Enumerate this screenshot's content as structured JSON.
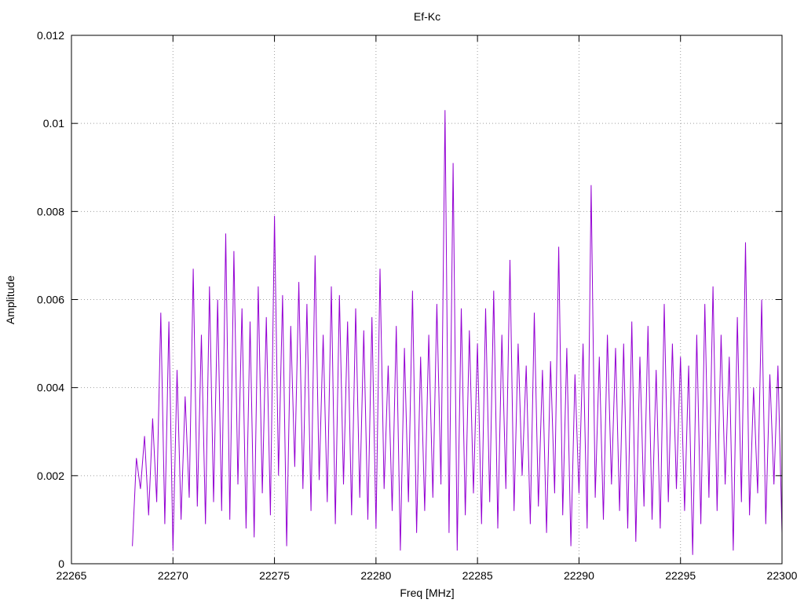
{
  "chart_data": {
    "type": "line",
    "title": "Ef-Kc",
    "xlabel": "Freq [MHz]",
    "ylabel": "Amplitude",
    "xlim": [
      22265,
      22300
    ],
    "ylim": [
      0,
      0.012
    ],
    "grid": true,
    "x_ticks": [
      "22265",
      "22270",
      "22275",
      "22280",
      "22285",
      "22290",
      "22295",
      "22300"
    ],
    "y_ticks": [
      "0",
      "0.002",
      "0.004",
      "0.006",
      "0.008",
      "0.01",
      "0.012"
    ],
    "series": [
      {
        "color": "#9400d3",
        "x": [
          22268.0,
          22268.2,
          22268.4,
          22268.6,
          22268.8,
          22269.0,
          22269.2,
          22269.4,
          22269.6,
          22269.8,
          22270.0,
          22270.2,
          22270.4,
          22270.6,
          22270.8,
          22271.0,
          22271.2,
          22271.4,
          22271.6,
          22271.8,
          22272.0,
          22272.2,
          22272.4,
          22272.6,
          22272.8,
          22273.0,
          22273.2,
          22273.4,
          22273.6,
          22273.8,
          22274.0,
          22274.2,
          22274.4,
          22274.6,
          22274.8,
          22275.0,
          22275.2,
          22275.4,
          22275.6,
          22275.8,
          22276.0,
          22276.2,
          22276.4,
          22276.6,
          22276.8,
          22277.0,
          22277.2,
          22277.4,
          22277.6,
          22277.8,
          22278.0,
          22278.2,
          22278.4,
          22278.6,
          22278.8,
          22279.0,
          22279.2,
          22279.4,
          22279.6,
          22279.8,
          22280.0,
          22280.2,
          22280.4,
          22280.6,
          22280.8,
          22281.0,
          22281.2,
          22281.4,
          22281.6,
          22281.8,
          22282.0,
          22282.2,
          22282.4,
          22282.6,
          22282.8,
          22283.0,
          22283.2,
          22283.4,
          22283.6,
          22283.8,
          22284.0,
          22284.2,
          22284.4,
          22284.6,
          22284.8,
          22285.0,
          22285.2,
          22285.4,
          22285.6,
          22285.8,
          22286.0,
          22286.2,
          22286.4,
          22286.6,
          22286.8,
          22287.0,
          22287.2,
          22287.4,
          22287.6,
          22287.8,
          22288.0,
          22288.2,
          22288.4,
          22288.6,
          22288.8,
          22289.0,
          22289.2,
          22289.4,
          22289.6,
          22289.8,
          22290.0,
          22290.2,
          22290.4,
          22290.6,
          22290.8,
          22291.0,
          22291.2,
          22291.4,
          22291.6,
          22291.8,
          22292.0,
          22292.2,
          22292.4,
          22292.6,
          22292.8,
          22293.0,
          22293.2,
          22293.4,
          22293.6,
          22293.8,
          22294.0,
          22294.2,
          22294.4,
          22294.6,
          22294.8,
          22295.0,
          22295.2,
          22295.4,
          22295.6,
          22295.8,
          22296.0,
          22296.2,
          22296.4,
          22296.6,
          22296.8,
          22297.0,
          22297.2,
          22297.4,
          22297.6,
          22297.8,
          22298.0,
          22298.2,
          22298.4,
          22298.6,
          22298.8,
          22299.0,
          22299.2,
          22299.4,
          22299.6,
          22299.8,
          22300.0
        ],
        "y": [
          0.0004,
          0.0024,
          0.0017,
          0.0029,
          0.0011,
          0.0033,
          0.0014,
          0.0057,
          0.0009,
          0.0055,
          0.0003,
          0.0044,
          0.001,
          0.0038,
          0.0015,
          0.0067,
          0.0013,
          0.0052,
          0.0009,
          0.0063,
          0.0014,
          0.006,
          0.0012,
          0.0075,
          0.001,
          0.0071,
          0.0018,
          0.0058,
          0.0008,
          0.0055,
          0.0006,
          0.0063,
          0.0016,
          0.0056,
          0.0011,
          0.0079,
          0.002,
          0.0061,
          0.0004,
          0.0054,
          0.0022,
          0.0064,
          0.0017,
          0.0059,
          0.0012,
          0.007,
          0.0019,
          0.0052,
          0.0014,
          0.0063,
          0.0009,
          0.0061,
          0.0018,
          0.0055,
          0.0011,
          0.0058,
          0.0015,
          0.0053,
          0.001,
          0.0056,
          0.0008,
          0.0067,
          0.0017,
          0.0045,
          0.0012,
          0.0054,
          0.0003,
          0.0049,
          0.0014,
          0.0062,
          0.0007,
          0.0047,
          0.0012,
          0.0052,
          0.0015,
          0.0059,
          0.0018,
          0.0103,
          0.0007,
          0.0091,
          0.0003,
          0.0058,
          0.0011,
          0.0053,
          0.0016,
          0.005,
          0.0009,
          0.0058,
          0.0014,
          0.0062,
          0.0008,
          0.0052,
          0.0017,
          0.0069,
          0.0012,
          0.005,
          0.002,
          0.0045,
          0.0009,
          0.0057,
          0.0013,
          0.0044,
          0.0007,
          0.0046,
          0.0016,
          0.0072,
          0.0011,
          0.0049,
          0.0004,
          0.0043,
          0.0016,
          0.005,
          0.0008,
          0.0086,
          0.0015,
          0.0047,
          0.001,
          0.0052,
          0.0018,
          0.0049,
          0.0012,
          0.005,
          0.0008,
          0.0055,
          0.0005,
          0.0047,
          0.0013,
          0.0054,
          0.001,
          0.0044,
          0.0008,
          0.0059,
          0.0014,
          0.005,
          0.0017,
          0.0047,
          0.0012,
          0.0045,
          0.0002,
          0.0052,
          0.0009,
          0.0059,
          0.0015,
          0.0063,
          0.0012,
          0.0052,
          0.0018,
          0.0047,
          0.0003,
          0.0056,
          0.0014,
          0.0073,
          0.0011,
          0.004,
          0.0016,
          0.006,
          0.0009,
          0.0043,
          0.0018,
          0.0045,
          0.0007
        ]
      }
    ]
  }
}
